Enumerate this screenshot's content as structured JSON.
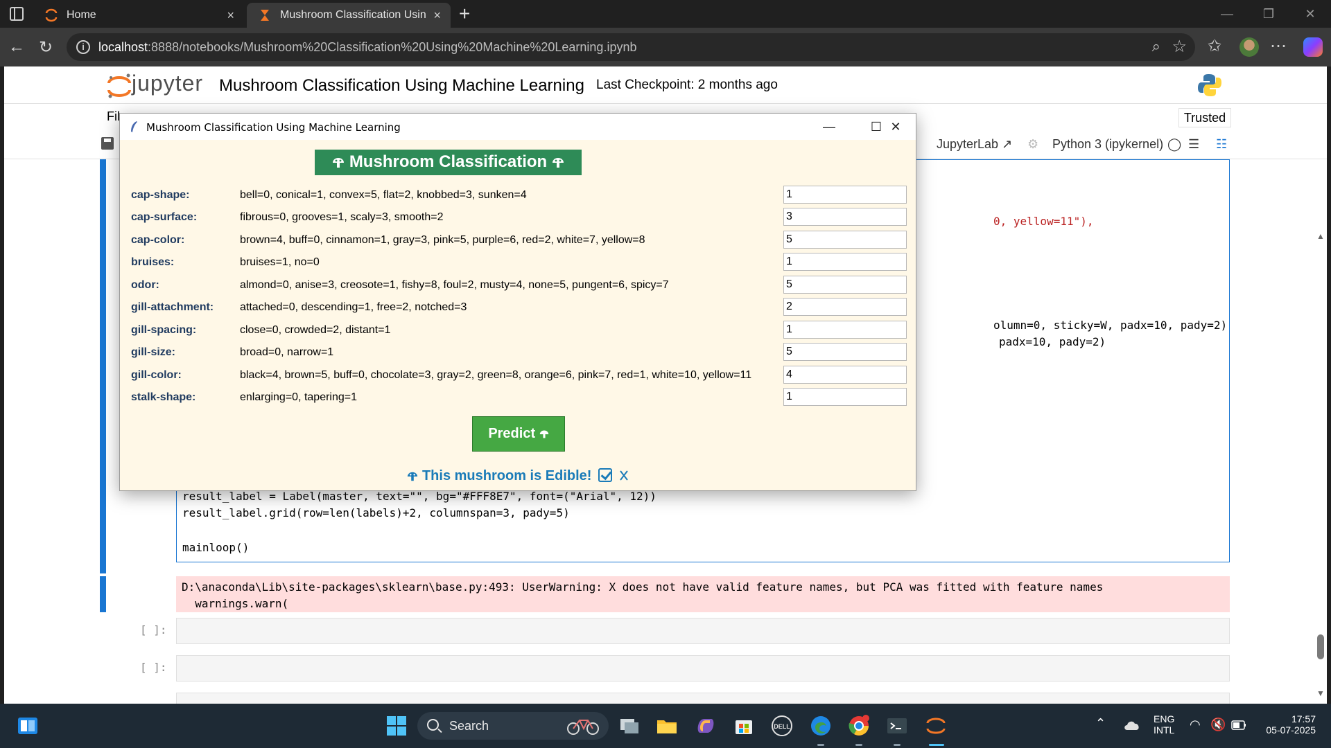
{
  "browser": {
    "tabs": [
      {
        "label": "Home",
        "close": "×"
      },
      {
        "label": "Mushroom Classification Using Machine Learning",
        "close": "×"
      }
    ],
    "new_tab": "+",
    "url_host": "localhost",
    "url_rest": ":8888/notebooks/Mushroom%20Classification%20Using%20Machine%20Learning.ipynb"
  },
  "jupyter": {
    "logo_text": "jupyter",
    "notebook_title": "Mushroom Classification Using Machine Learning",
    "checkpoint": "Last Checkpoint: 2 months ago",
    "menu_file_partial": "Fil",
    "trusted": "Trusted",
    "jupyterlab": "JupyterLab",
    "kernel": "Python 3 (ipykernel)"
  },
  "code": {
    "line_top1": "0, yellow=11\"),",
    "line_top2a": "olumn=0, sticky=W, padx=10, pady=2)",
    "line_top2b": "padx=10, pady=2)",
    "line1": "result_label = Label(master, text=\"\", bg=\"#FFF8E7\", font=(\"Arial\", 12))",
    "line2": "result_label.grid(row=len(labels)+2, columnspan=3, pady=5)",
    "line3": "mainloop()"
  },
  "output": {
    "warning_line1": "D:\\anaconda\\Lib\\site-packages\\sklearn\\base.py:493: UserWarning: X does not have valid feature names, but PCA was fitted with feature names",
    "warning_line2": "  warnings.warn("
  },
  "empty_cells": [
    {
      "prompt": "[ ]:"
    },
    {
      "prompt": "[ ]:"
    }
  ],
  "dialog": {
    "title": "Mushroom Classification Using Machine Learning",
    "banner": "Mushroom Classification",
    "fields": [
      {
        "name": "cap-shape:",
        "desc": "bell=0, conical=1, convex=5, flat=2, knobbed=3, sunken=4",
        "value": "1"
      },
      {
        "name": "cap-surface:",
        "desc": "fibrous=0, grooves=1, scaly=3, smooth=2",
        "value": "3"
      },
      {
        "name": "cap-color:",
        "desc": "brown=4, buff=0, cinnamon=1, gray=3, pink=5, purple=6, red=2, white=7, yellow=8",
        "value": "5"
      },
      {
        "name": "bruises:",
        "desc": "bruises=1, no=0",
        "value": "1"
      },
      {
        "name": "odor:",
        "desc": "almond=0, anise=3, creosote=1, fishy=8, foul=2, musty=4, none=5, pungent=6, spicy=7",
        "value": "5"
      },
      {
        "name": "gill-attachment:",
        "desc": "attached=0, descending=1, free=2, notched=3",
        "value": "2"
      },
      {
        "name": "gill-spacing:",
        "desc": "close=0, crowded=2, distant=1",
        "value": "1"
      },
      {
        "name": "gill-size:",
        "desc": "broad=0, narrow=1",
        "value": "5"
      },
      {
        "name": "gill-color:",
        "desc": "black=4, brown=5, buff=0, chocolate=3, gray=2, green=8, orange=6, pink=7, red=1, white=10, yellow=11",
        "value": "4"
      },
      {
        "name": "stalk-shape:",
        "desc": "enlarging=0, tapering=1",
        "value": "1"
      }
    ],
    "predict": "Predict",
    "result": "This mushroom is Edible!"
  },
  "taskbar": {
    "search": "Search",
    "lang1": "ENG",
    "lang2": "INTL",
    "time": "17:57",
    "date": "05-07-2025"
  },
  "colors": {
    "banner_bg": "#2e8b57",
    "dialog_bg": "#fff8e7",
    "predict_bg": "#45a843",
    "result_text": "#1a7bb8",
    "cell_selected": "#1976d2"
  }
}
